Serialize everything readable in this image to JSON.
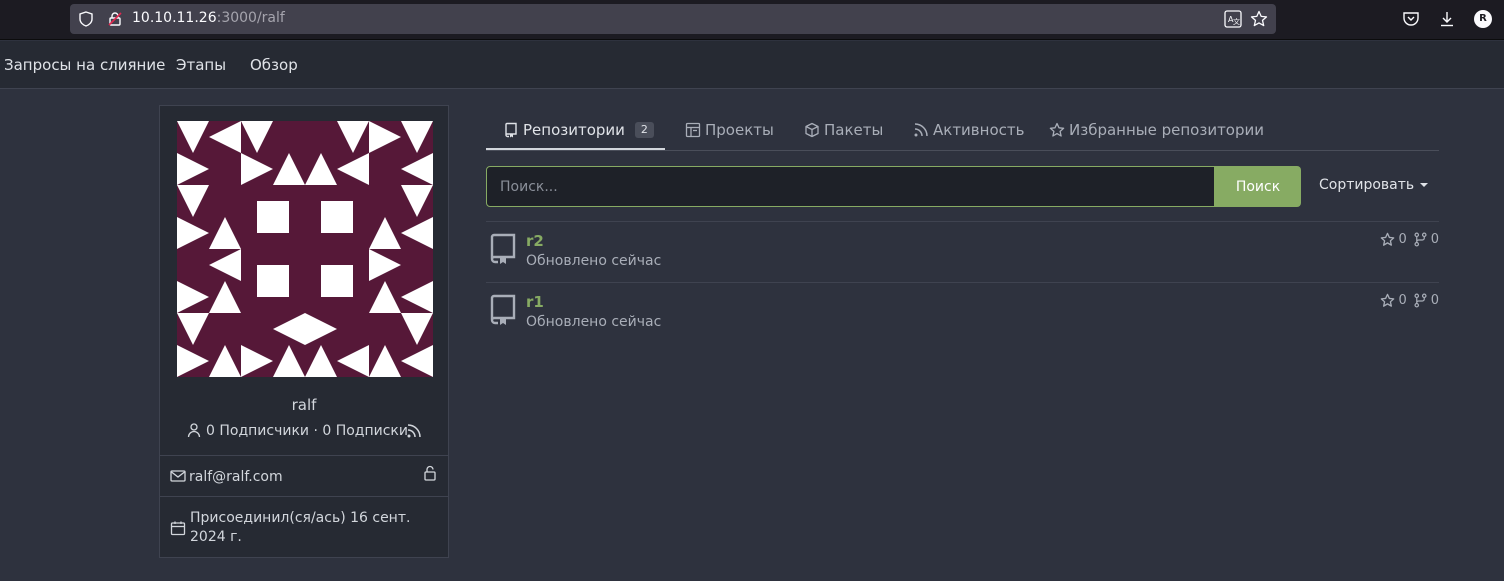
{
  "browser": {
    "url_host": "10.10.11.26",
    "url_rest": ":3000/ralf",
    "account_initial": "R"
  },
  "navbar": {
    "items": [
      {
        "label": "Запросы на слияние"
      },
      {
        "label": "Этапы"
      },
      {
        "label": "Обзор"
      }
    ]
  },
  "profile": {
    "username": "ralf",
    "followers_text": "0 Подписчики · 0 Подписки",
    "email": "ralf@ralf.com",
    "joined": "Присоединил(ся/ась) 16 сент. 2024 г.",
    "avatar_colors": {
      "background": "#561838",
      "foreground": "#ffffff"
    }
  },
  "tabs": [
    {
      "label": "Репозитории",
      "badge": "2",
      "icon": "repo-icon",
      "active": true
    },
    {
      "label": "Проекты",
      "icon": "project-icon",
      "active": false
    },
    {
      "label": "Пакеты",
      "icon": "package-icon",
      "active": false
    },
    {
      "label": "Активность",
      "icon": "rss-icon",
      "active": false
    },
    {
      "label": "Избранные репозитории",
      "icon": "star-icon",
      "active": false
    }
  ],
  "search": {
    "placeholder": "Поиск...",
    "button_label": "Поиск",
    "sort_label": "Сортировать"
  },
  "repos": [
    {
      "name": "r2",
      "updated": "Обновлено сейчас",
      "stars": "0",
      "forks": "0"
    },
    {
      "name": "r1",
      "updated": "Обновлено сейчас",
      "stars": "0",
      "forks": "0"
    }
  ],
  "colors": {
    "accent": "#87ab63",
    "page_bg": "#2e323e",
    "card_bg": "#262a33"
  }
}
